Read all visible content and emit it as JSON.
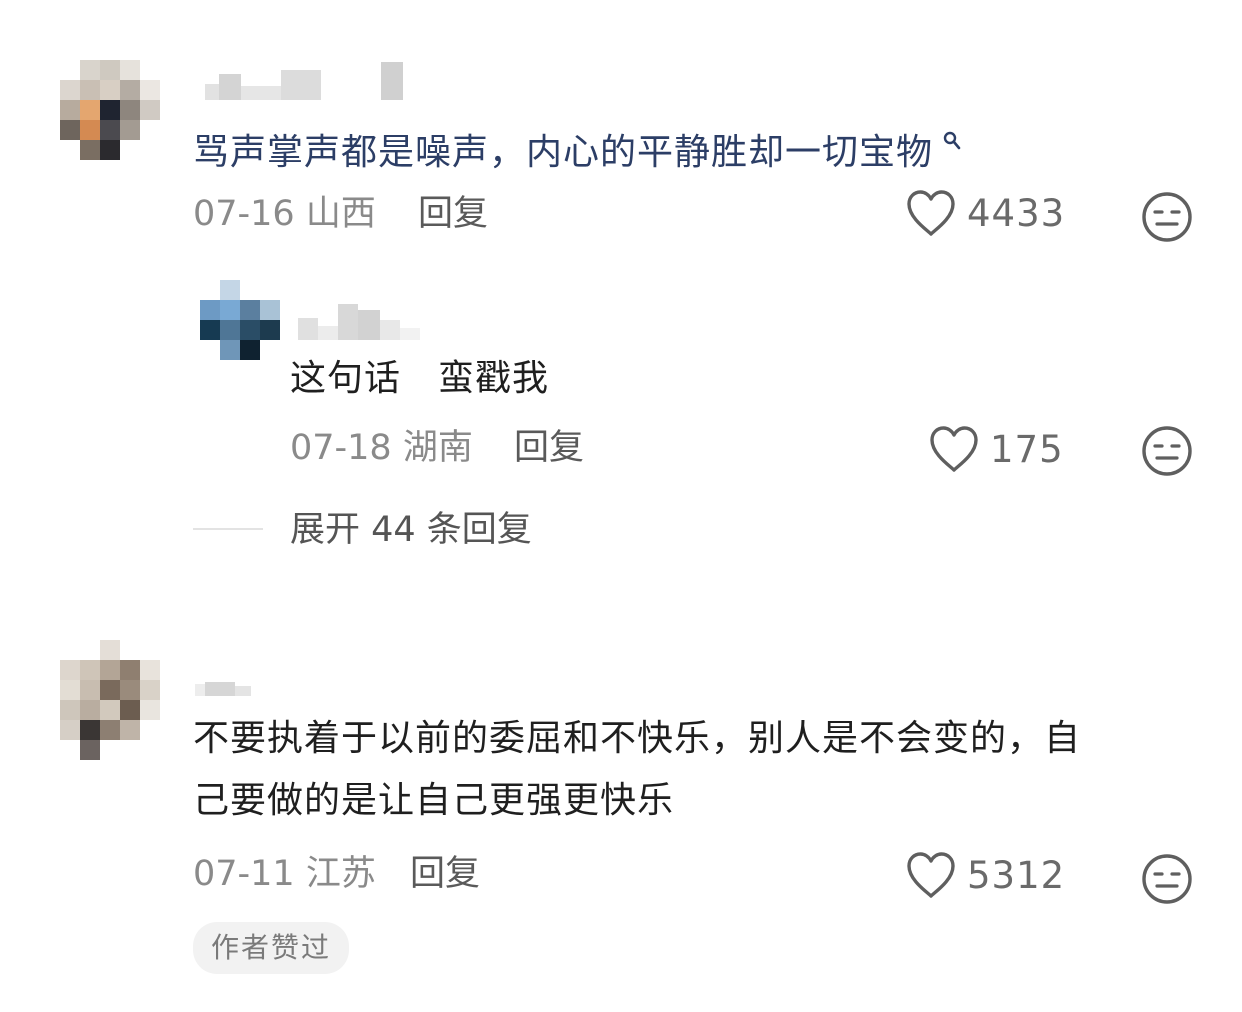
{
  "comments": [
    {
      "text": "骂声掌声都是噪声，内心的平静胜却一切宝物",
      "date": "07-16",
      "location": "山西",
      "reply_label": "回复",
      "likes": "4433",
      "replies": [
        {
          "text": "这句话　蛮戳我",
          "date": "07-18",
          "location": "湖南",
          "reply_label": "回复",
          "likes": "175"
        }
      ],
      "expand_label": "展开 44 条回复"
    },
    {
      "text_line1": "不要执着于以前的委屈和不快乐，别人是不会变的，自",
      "text_line2": "己要做的是让自己更强更快乐",
      "date": "07-11",
      "location": "江苏",
      "reply_label": "回复",
      "likes": "5312",
      "author_badge": "作者赞过"
    }
  ],
  "colors": {
    "link_text": "#2c3e66",
    "meta_text": "#8a8a8a",
    "icon": "#5f5f5f"
  },
  "icons": {
    "like": "heart-outline-icon",
    "reaction": "neutral-face-icon",
    "search_hint": "search-icon"
  }
}
